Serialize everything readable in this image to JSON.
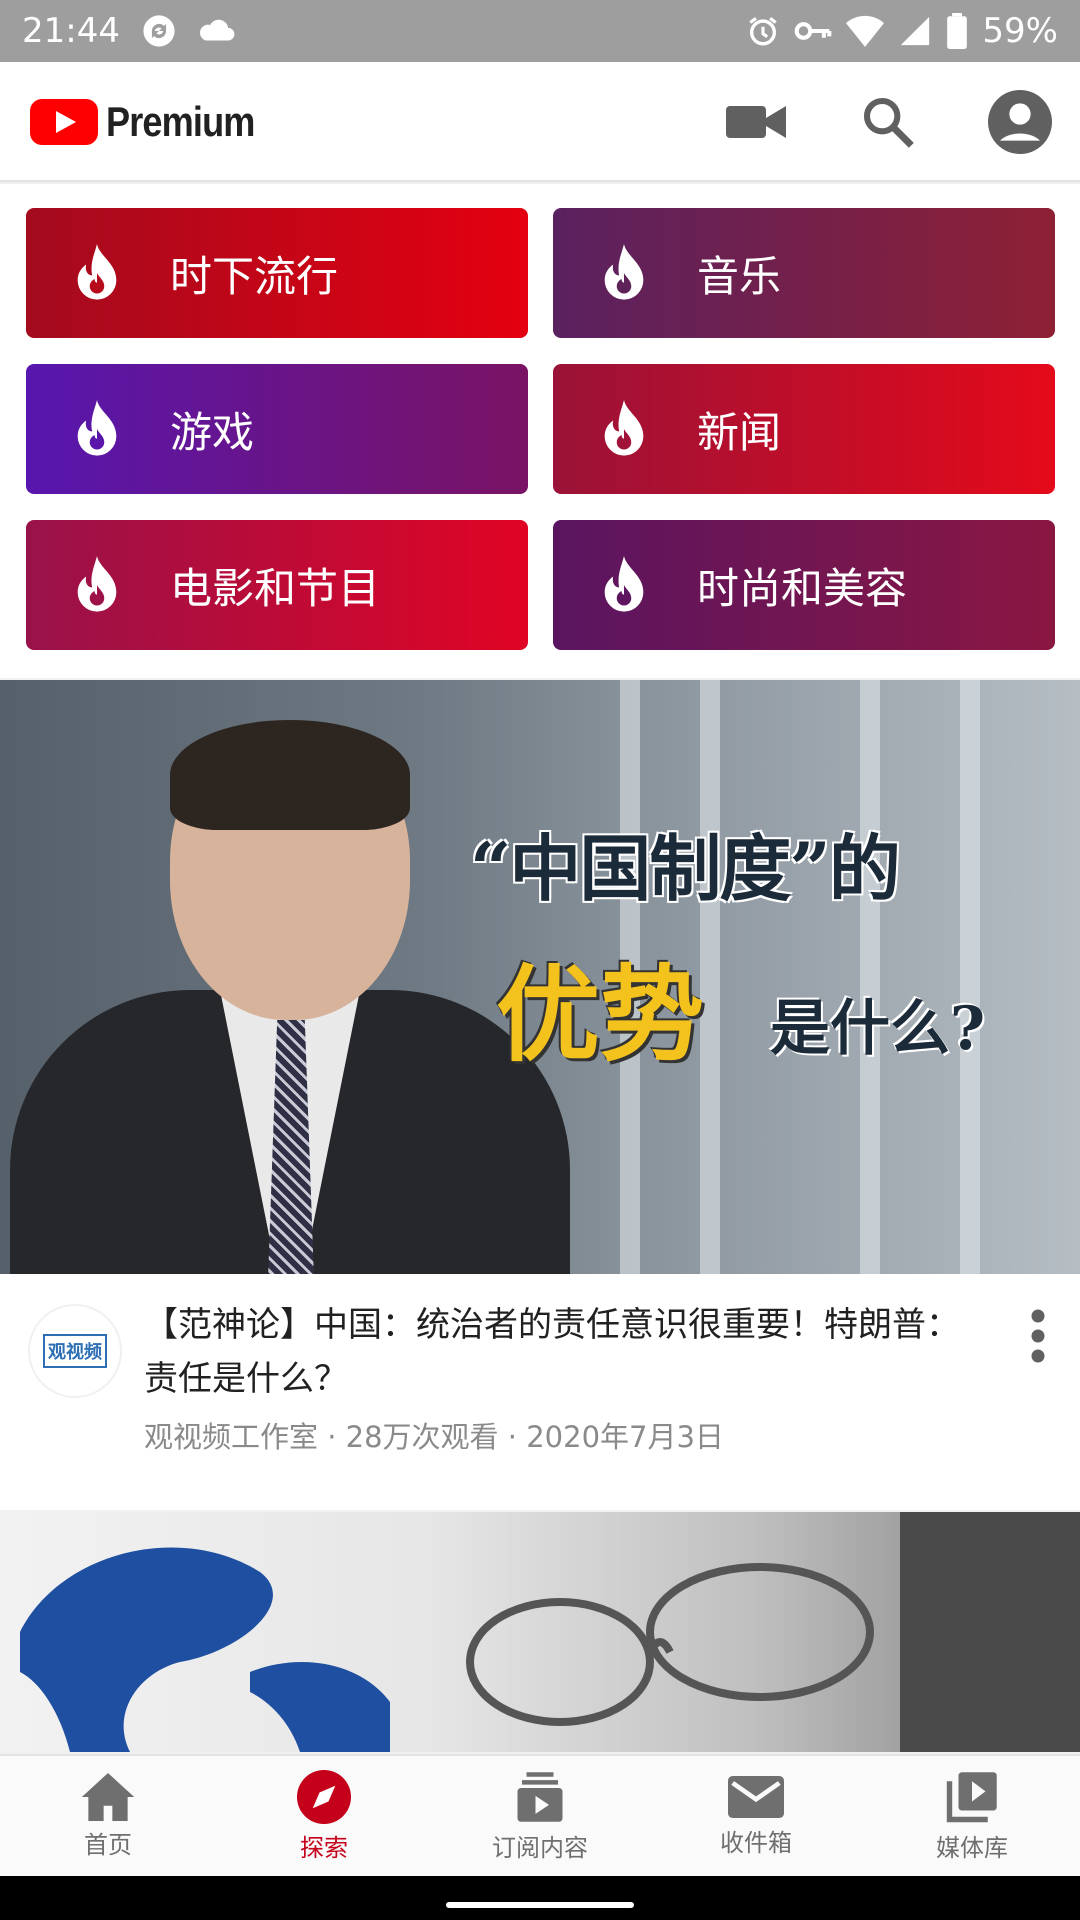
{
  "status_bar": {
    "time": "21:44",
    "battery": "59%"
  },
  "app_bar": {
    "logo_text": "Premium"
  },
  "categories": [
    {
      "label": "时下流行"
    },
    {
      "label": "音乐"
    },
    {
      "label": "游戏"
    },
    {
      "label": "新闻"
    },
    {
      "label": "电影和节目"
    },
    {
      "label": "时尚和美容"
    }
  ],
  "video": {
    "thumb_line1": "“中国制度”的",
    "thumb_line2": "优势",
    "thumb_line3": "是什么?",
    "channel_logo_text": "观视频",
    "title": "【范神论】中国：统治者的责任意识很重要！特朗普：责任是什么？",
    "meta": "观视频工作室 · 28万次观看 · 2020年7月3日"
  },
  "bottom_nav": {
    "items": [
      {
        "label": "首页"
      },
      {
        "label": "探索"
      },
      {
        "label": "订阅内容"
      },
      {
        "label": "收件箱"
      },
      {
        "label": "媒体库"
      }
    ],
    "active_index": 1
  },
  "colors": {
    "accent": "#c4001a",
    "youtube_red": "#ff0000"
  }
}
